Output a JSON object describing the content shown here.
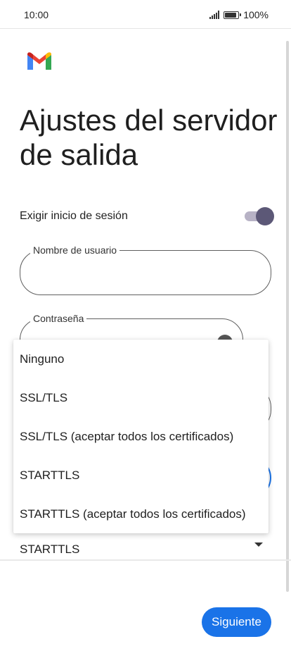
{
  "status_bar": {
    "time": "10:00",
    "battery": "100%"
  },
  "page": {
    "title": "Ajustes del servidor de salida"
  },
  "login_toggle": {
    "label": "Exigir inicio de sesión",
    "enabled": true
  },
  "fields": {
    "username": {
      "label": "Nombre de usuario",
      "value": ""
    },
    "password": {
      "label": "Contraseña",
      "value": ""
    }
  },
  "security": {
    "selected": "STARTTLS",
    "options": [
      "Ninguno",
      "SSL/TLS",
      "SSL/TLS (aceptar todos los certificados)",
      "STARTTLS",
      "STARTTLS (aceptar todos los certificados)"
    ]
  },
  "actions": {
    "next_label": "Siguiente"
  },
  "colors": {
    "primary": "#1a73e8",
    "toggle_knob": "#5c5877",
    "toggle_track": "#b7b2c5"
  }
}
